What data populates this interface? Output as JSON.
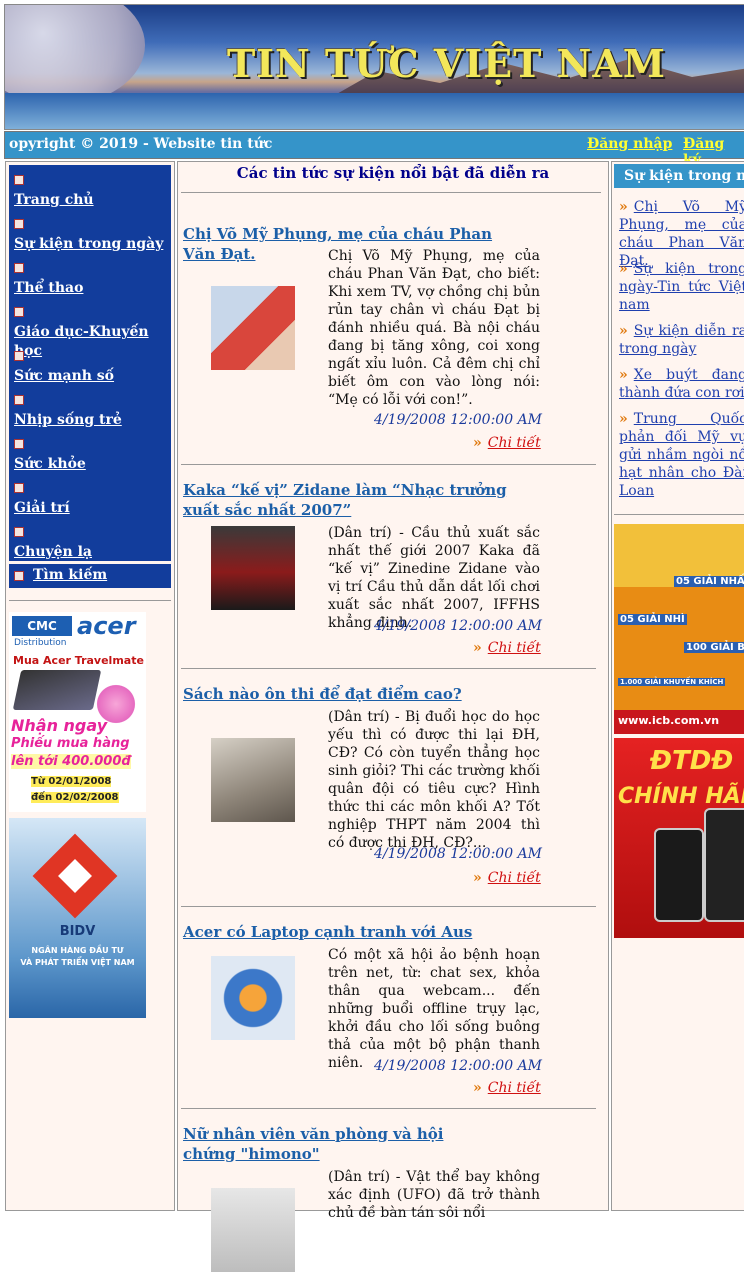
{
  "header": {
    "title": "TIN TỨC VIỆT NAM",
    "copyright": "opyright © 2019 - Website tin tức",
    "login_label": "Đăng nhập",
    "register_label": "Đăng ký"
  },
  "sidebar": {
    "items": [
      {
        "label": "Trang chủ"
      },
      {
        "label": "Sự kiện trong ngày"
      },
      {
        "label": "Thể thao"
      },
      {
        "label": "Giáo dục-Khuyến học"
      },
      {
        "label": "Sức mạnh số"
      },
      {
        "label": "Nhịp sống trẻ"
      },
      {
        "label": "Sức khỏe"
      },
      {
        "label": "Giải trí"
      },
      {
        "label": "Chuyện lạ"
      }
    ],
    "search_label": "Tìm kiếm"
  },
  "ads_left": {
    "acer": {
      "brand1": "CMC",
      "brand1_sub": "Distribution",
      "brand2": "acer",
      "line1": "Mua Acer Travelmate",
      "line2": "Nhận ngay",
      "line3": "Phiếu mua hàng",
      "line4": "lên tới 400.000đ",
      "line5": "Từ 02/01/2008",
      "line6": "đến 02/02/2008"
    },
    "bidv": {
      "brand": "BIDV",
      "line1": "NGÂN HÀNG ĐẦU TƯ",
      "line2": "VÀ PHÁT TRIỂN VIỆT NAM"
    }
  },
  "main": {
    "heading": "Các tin tức sự kiện nổi bật đã diễn ra",
    "more_label": "Chi tiết",
    "articles": [
      {
        "title": "Chị Võ Mỹ Phụng, mẹ của cháu Phan Văn Đạt.",
        "summary": "Chị Võ Mỹ Phụng, mẹ của cháu Phan Văn Đạt, cho biết: Khi xem TV, vợ chồng chị bủn rủn tay chân vì cháu Đạt bị đánh nhiều quá. Bà nội cháu đang bị tăng xông, coi xong ngất xỉu luôn. Cả đêm chị chỉ biết ôm con vào lòng nói: “Mẹ có lỗi với con!”.",
        "date": "4/19/2008 12:00:00 AM"
      },
      {
        "title": "Kaka “kế vị” Zidane làm “Nhạc trưởng xuất sắc nhất 2007”",
        "summary": "(Dân trí) - Cầu thủ xuất sắc nhất thế giới 2007 Kaka đã “kế vị” Zinedine Zidane vào vị trí Cầu thủ dẫn dắt lối chơi xuất sắc nhất 2007, IFFHS khẳng định.",
        "date": "4/19/2008 12:00:00 AM"
      },
      {
        "title": "Sách nào ôn thi để đạt điểm cao?",
        "summary": "(Dân trí) - Bị đuổi học do học yếu thì có được thi lại ĐH, CĐ? Có còn tuyển thẳng học sinh giỏi? Thi các trường khối quân đội có tiêu cực? Hình thức thi các môn khối A? Tốt nghiệp THPT năm 2004 thì có được thi ĐH, CĐ?...",
        "date": "4/19/2008 12:00:00 AM"
      },
      {
        "title": "Acer có Laptop cạnh tranh với Aus",
        "summary": "Có một xã hội ảo bệnh hoạn trên net, từ: chat sex, khỏa thân qua webcam... đến những buổi offline trụy lạc, khởi đầu cho lối sống buông thả của một bộ phận thanh niên.",
        "date": "4/19/2008 12:00:00 AM"
      },
      {
        "title": "Nữ nhân viên văn phòng và hội chứng \"himono\"",
        "summary": "(Dân trí) - Vật thể bay không xác định (UFO) đã trở thành chủ đề bàn tán sôi nổi",
        "date": ""
      }
    ]
  },
  "right": {
    "heading": "Sự kiện trong ngày",
    "items": [
      {
        "text": "Chị Võ Mỹ Phụng, mẹ của cháu Phan Văn Đạt."
      },
      {
        "text": "Sự kiện trong ngày-Tin tức Việt nam"
      },
      {
        "text": "Sự kiện diễn ra trong ngày"
      },
      {
        "text": "Xe buýt đang thành đứa con rơi"
      },
      {
        "text": "Trung Quốc phản đối Mỹ vụ gửi nhầm ngòi nổ hạt nhân cho Đài Loan"
      }
    ],
    "ad_icb": {
      "line1": "05 GIẢI NHẤT",
      "line2": "05 GIẢI NHÌ",
      "line3": "100 GIẢI BA",
      "line4": "1.000 GIẢI KHUYẾN KHÍCH",
      "url": "www.icb.com.vn"
    },
    "ad_phone": {
      "line1": "ĐTDĐ",
      "line2": "CHÍNH HÃNG"
    }
  },
  "colors": {
    "menu_bg": "#123d9c",
    "bar_bg": "#3594c9",
    "link": "#1c5fa8",
    "page_bg": "#fff5f0"
  }
}
